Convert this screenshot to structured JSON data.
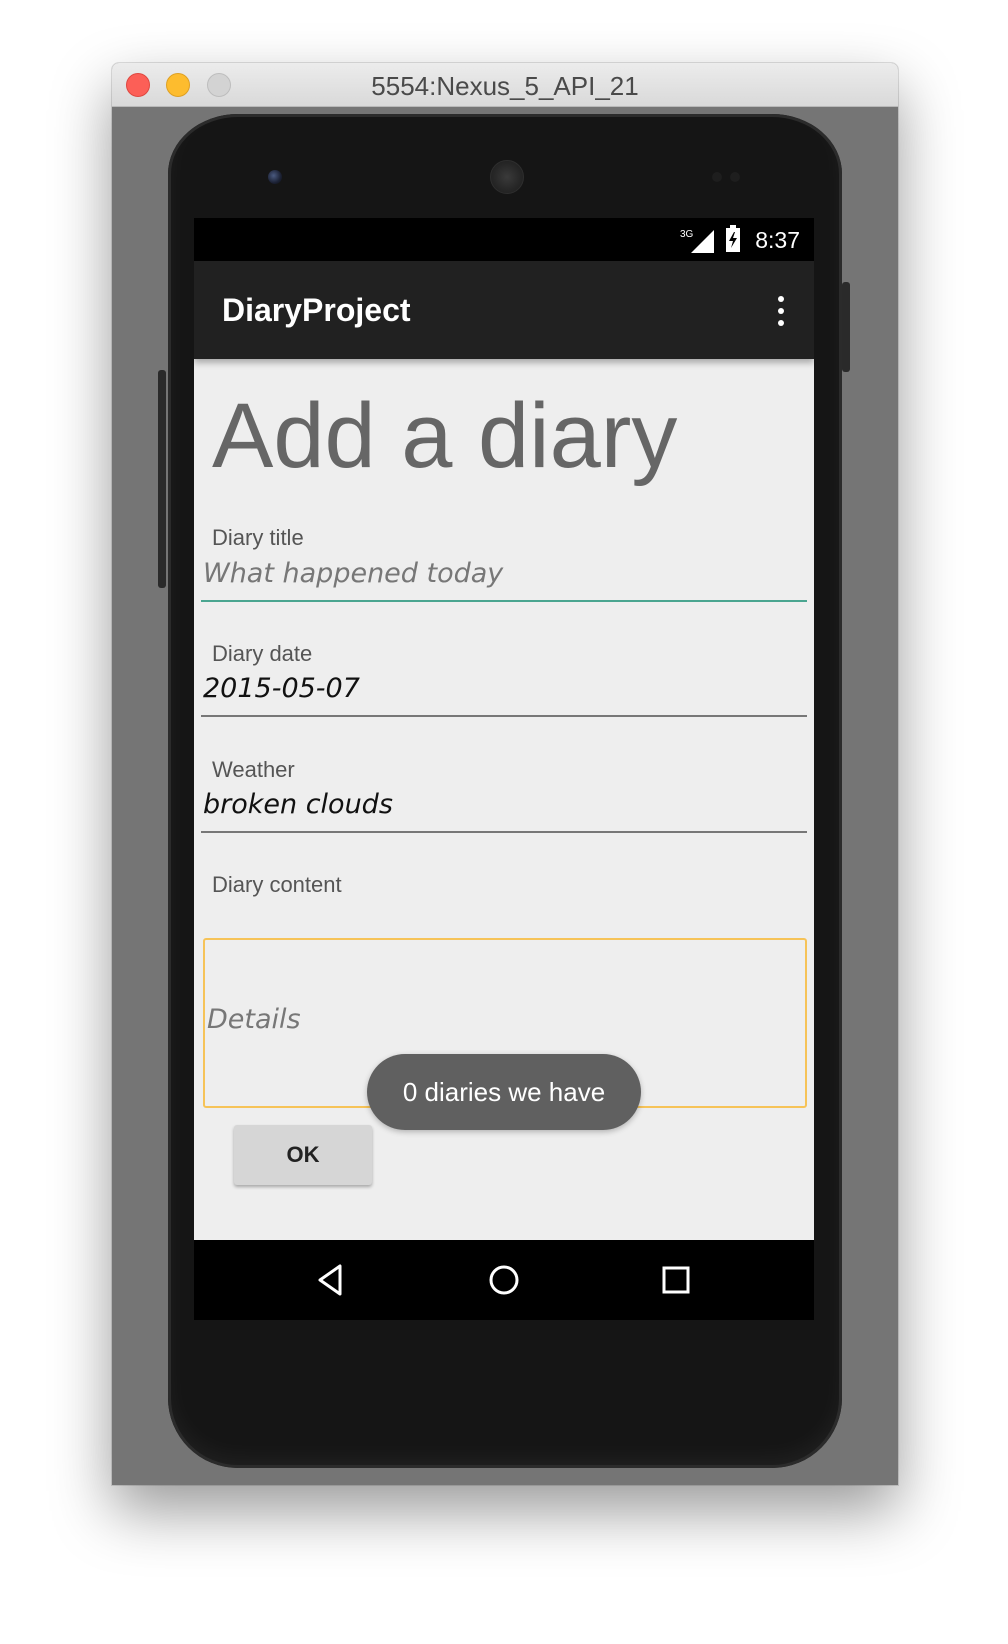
{
  "window": {
    "title": "5554:Nexus_5_API_21"
  },
  "status_bar": {
    "signal_label": "3G",
    "time": "8:37"
  },
  "app_bar": {
    "title": "DiaryProject",
    "overflow_icon": "more-vert-icon"
  },
  "form": {
    "heading": "Add a diary",
    "title_field": {
      "label": "Diary title",
      "value": "",
      "placeholder": "What happened today"
    },
    "date_field": {
      "label": "Diary date",
      "value": "2015-05-07"
    },
    "weather_field": {
      "label": "Weather",
      "value": "broken clouds"
    },
    "content_field": {
      "label": "Diary content",
      "value": "",
      "placeholder": "Details"
    },
    "ok_label": "OK"
  },
  "toast": {
    "message": "0 diaries we have"
  },
  "nav_bar": {
    "icons": [
      "back-icon",
      "home-icon",
      "recents-icon"
    ]
  },
  "colors": {
    "app_bar": "#212121",
    "screen_background": "#eeeeee",
    "focused_underline": "#4aa590",
    "content_border": "#f6c358",
    "toast_background": "#606060"
  }
}
